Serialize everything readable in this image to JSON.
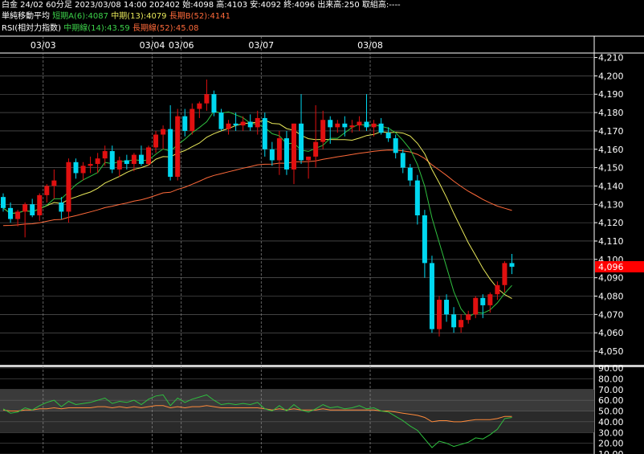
{
  "header": {
    "line1": "白金 24/02 60分足 2023/03/08 14:00 202402 始:4098 高:4103 安:4092 終:4096 出来高:250 取組高:----",
    "ma_title": "単純移動平均",
    "ma_a": "短期A(6):4087",
    "ma_m": "中期(13):4079",
    "ma_b": "長期B(52):4141",
    "rsi_title": "RSI(相対力指数)",
    "rsi_m": "中期線(14):43.59",
    "rsi_l": "長期線(52):45.08"
  },
  "colors": {
    "up": "#e01010",
    "down": "#00d8f0",
    "ma6": "#2fbf3f",
    "ma13": "#e8e85a",
    "ma52": "#ff6a3a",
    "rsi14": "#2fbf3f",
    "rsi52": "#ff8a3a",
    "current_price_bg": "#ff0000"
  },
  "chart_data": [
    {
      "type": "candlestick",
      "title": "白金 24/02 60分足",
      "x_date_labels": [
        {
          "index": 6,
          "label": "03/03"
        },
        {
          "index": 21,
          "label": "03/04"
        },
        {
          "index": 25,
          "label": "03/06"
        },
        {
          "index": 36,
          "label": "03/07"
        },
        {
          "index": 51,
          "label": "03/08"
        }
      ],
      "ylim": [
        4043,
        4212
      ],
      "y_ticks": [
        4050,
        4060,
        4070,
        4080,
        4090,
        4100,
        4110,
        4120,
        4130,
        4140,
        4150,
        4160,
        4170,
        4180,
        4190,
        4200,
        4210
      ],
      "y_tick_labels": [
        "4,050",
        "4,060",
        "4,070",
        "4,080",
        "4,090",
        "4,100",
        "4,110",
        "4,120",
        "4,130",
        "4,140",
        "4,150",
        "4,160",
        "4,170",
        "4,180",
        "4,190",
        "4,200",
        "4,210"
      ],
      "current_price_label": "4,096",
      "current_price": 4096,
      "ohlc": [
        [
          4134,
          4136,
          4126,
          4128
        ],
        [
          4128,
          4131,
          4120,
          4122
        ],
        [
          4122,
          4127,
          4118,
          4126
        ],
        [
          4126,
          4131,
          4112,
          4130
        ],
        [
          4130,
          4133,
          4123,
          4124
        ],
        [
          4124,
          4136,
          4121,
          4135
        ],
        [
          4135,
          4141,
          4131,
          4140
        ],
        [
          4140,
          4149,
          4133,
          4143
        ],
        [
          4131,
          4134,
          4122,
          4126
        ],
        [
          4126,
          4155,
          4120,
          4153
        ],
        [
          4153,
          4155,
          4144,
          4147
        ],
        [
          4147,
          4153,
          4143,
          4151
        ],
        [
          4151,
          4156,
          4147,
          4152
        ],
        [
          4152,
          4158,
          4147,
          4155
        ],
        [
          4155,
          4162,
          4151,
          4159
        ],
        [
          4159,
          4162,
          4147,
          4149
        ],
        [
          4149,
          4156,
          4145,
          4154
        ],
        [
          4154,
          4157,
          4149,
          4152
        ],
        [
          4152,
          4158,
          4148,
          4157
        ],
        [
          4157,
          4162,
          4151,
          4152
        ],
        [
          4152,
          4162,
          4151,
          4161
        ],
        [
          4161,
          4170,
          4158,
          4168
        ],
        [
          4168,
          4173,
          4160,
          4171
        ],
        [
          4171,
          4184,
          4143,
          4145
        ],
        [
          4145,
          4182,
          4143,
          4178
        ],
        [
          4178,
          4182,
          4167,
          4170
        ],
        [
          4170,
          4185,
          4168,
          4182
        ],
        [
          4182,
          4186,
          4177,
          4185
        ],
        [
          4185,
          4198,
          4181,
          4190
        ],
        [
          4190,
          4192,
          4178,
          4180
        ],
        [
          4180,
          4182,
          4170,
          4171
        ],
        [
          4171,
          4176,
          4168,
          4174
        ],
        [
          4174,
          4180,
          4170,
          4173
        ],
        [
          4173,
          4178,
          4170,
          4175
        ],
        [
          4175,
          4179,
          4170,
          4172
        ],
        [
          4172,
          4181,
          4168,
          4177
        ],
        [
          4177,
          4180,
          4156,
          4160
        ],
        [
          4160,
          4164,
          4151,
          4154
        ],
        [
          4154,
          4170,
          4146,
          4166
        ],
        [
          4166,
          4170,
          4146,
          4149
        ],
        [
          4149,
          4174,
          4141,
          4174
        ],
        [
          4174,
          4190,
          4152,
          4154
        ],
        [
          4154,
          4156,
          4144,
          4156
        ],
        [
          4156,
          4184,
          4150,
          4164
        ],
        [
          4164,
          4181,
          4160,
          4176
        ],
        [
          4176,
          4178,
          4163,
          4172
        ],
        [
          4172,
          4176,
          4169,
          4174
        ],
        [
          4174,
          4178,
          4167,
          4172
        ],
        [
          4172,
          4176,
          4169,
          4173
        ],
        [
          4173,
          4178,
          4170,
          4175
        ],
        [
          4175,
          4190,
          4170,
          4172
        ],
        [
          4172,
          4176,
          4167,
          4174
        ],
        [
          4174,
          4177,
          4168,
          4169
        ],
        [
          4169,
          4172,
          4164,
          4166
        ],
        [
          4166,
          4168,
          4155,
          4158
        ],
        [
          4158,
          4160,
          4147,
          4150
        ],
        [
          4150,
          4152,
          4140,
          4143
        ],
        [
          4143,
          4146,
          4119,
          4124
        ],
        [
          4124,
          4127,
          4090,
          4098
        ],
        [
          4098,
          4102,
          4060,
          4062
        ],
        [
          4062,
          4080,
          4058,
          4078
        ],
        [
          4078,
          4081,
          4066,
          4070
        ],
        [
          4070,
          4074,
          4060,
          4063
        ],
        [
          4063,
          4070,
          4060,
          4067
        ],
        [
          4067,
          4072,
          4065,
          4070
        ],
        [
          4070,
          4080,
          4068,
          4079
        ],
        [
          4079,
          4081,
          4068,
          4075
        ],
        [
          4075,
          4082,
          4071,
          4081
        ],
        [
          4081,
          4088,
          4078,
          4086
        ],
        [
          4086,
          4099,
          4082,
          4098
        ],
        [
          4098,
          4103,
          4092,
          4096
        ]
      ]
    },
    {
      "type": "line",
      "title": "RSI(相対力指数)",
      "ylim": [
        10,
        90
      ],
      "y_ticks": [
        10,
        20,
        30,
        40,
        50,
        60,
        70,
        80,
        90
      ],
      "y_tick_labels": [
        "10.00",
        "20.00",
        "30.00",
        "40.00",
        "50.00",
        "60.00",
        "70.00",
        "80.00",
        "90.00"
      ],
      "series": [
        {
          "name": "中期線(14)",
          "values": [
            52,
            48,
            49,
            53,
            51,
            55,
            58,
            60,
            54,
            59,
            56,
            57,
            58,
            60,
            62,
            57,
            59,
            58,
            60,
            56,
            61,
            64,
            65,
            55,
            62,
            58,
            61,
            63,
            65,
            60,
            56,
            57,
            56,
            57,
            56,
            58,
            52,
            50,
            55,
            50,
            56,
            51,
            49,
            52,
            56,
            53,
            54,
            52,
            53,
            55,
            52,
            53,
            50,
            49,
            45,
            41,
            36,
            32,
            24,
            16,
            22,
            20,
            17,
            19,
            21,
            25,
            24,
            28,
            33,
            43,
            44
          ]
        },
        {
          "name": "長期線(52)",
          "values": [
            51,
            50,
            50,
            51,
            51,
            52,
            52,
            53,
            52,
            53,
            53,
            53,
            53,
            54,
            54,
            53,
            54,
            53,
            54,
            53,
            54,
            55,
            55,
            53,
            54,
            53,
            54,
            54,
            55,
            54,
            53,
            53,
            53,
            53,
            53,
            53,
            52,
            51,
            52,
            51,
            52,
            51,
            51,
            51,
            52,
            51,
            51,
            51,
            51,
            51,
            51,
            51,
            50,
            50,
            49,
            48,
            47,
            46,
            44,
            40,
            41,
            41,
            40,
            40,
            41,
            42,
            42,
            42,
            43,
            45,
            45
          ]
        }
      ]
    }
  ]
}
